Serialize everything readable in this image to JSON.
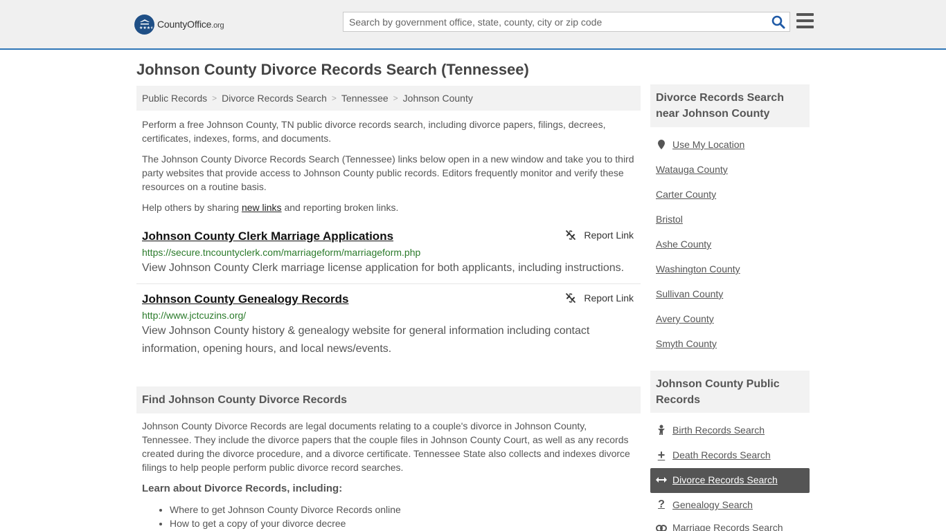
{
  "header": {
    "logo_main": "CountyOffice",
    "logo_suffix": ".org",
    "search_placeholder": "Search by government office, state, county, city or zip code"
  },
  "page": {
    "title": "Johnson County Divorce Records Search (Tennessee)"
  },
  "breadcrumb": [
    "Public Records",
    "Divorce Records Search",
    "Tennessee",
    "Johnson County"
  ],
  "intro": {
    "p1": "Perform a free Johnson County, TN public divorce records search, including divorce papers, filings, decrees, certificates, indexes, forms, and documents.",
    "p2": "The Johnson County Divorce Records Search (Tennessee) links below open in a new window and take you to third party websites that provide access to Johnson County public records. Editors frequently monitor and verify these resources on a routine basis.",
    "p3_before": "Help others by sharing ",
    "p3_link": "new links",
    "p3_after": " and reporting broken links."
  },
  "results": [
    {
      "title": "Johnson County Clerk Marriage Applications",
      "url": "https://secure.tncountyclerk.com/marriageform/marriageform.php",
      "desc": "View Johnson County Clerk marriage license application for both applicants, including instructions.",
      "report": "Report Link"
    },
    {
      "title": "Johnson County Genealogy Records",
      "url": "http://www.jctcuzins.org/",
      "desc": "View Johnson County history & genealogy website for general information including contact information, opening hours, and local news/events.",
      "report": "Report Link"
    }
  ],
  "find_section": {
    "heading": "Find Johnson County Divorce Records",
    "body": "Johnson County Divorce Records are legal documents relating to a couple's divorce in Johnson County, Tennessee. They include the divorce papers that the couple files in Johnson County Court, as well as any records created during the divorce procedure, and a divorce certificate. Tennessee State also collects and indexes divorce filings to help people perform public divorce record searches.",
    "learn_heading": "Learn about Divorce Records, including:",
    "bullets": [
      "Where to get Johnson County Divorce Records online",
      "How to get a copy of your divorce decree"
    ]
  },
  "sidebar": {
    "nearby_heading": "Divorce Records Search near Johnson County",
    "use_location": "Use My Location",
    "nearby": [
      "Watauga County",
      "Carter County",
      "Bristol",
      "Ashe County",
      "Washington County",
      "Sullivan County",
      "Avery County",
      "Smyth County"
    ],
    "public_heading": "Johnson County Public Records",
    "public_links": [
      {
        "label": "Birth Records Search",
        "icon": "baby-icon"
      },
      {
        "label": "Death Records Search",
        "icon": "plus-icon"
      },
      {
        "label": "Divorce Records Search",
        "icon": "arrows-icon"
      },
      {
        "label": "Genealogy Search",
        "icon": "question-icon"
      },
      {
        "label": "Marriage Records Search",
        "icon": "rings-icon"
      }
    ]
  },
  "colors": {
    "header_bg": "#f0f0f0",
    "header_border": "#2f76b7",
    "logo_blue": "#1f4f86",
    "url_green": "#2a7a2a",
    "active_bg": "#555555"
  }
}
